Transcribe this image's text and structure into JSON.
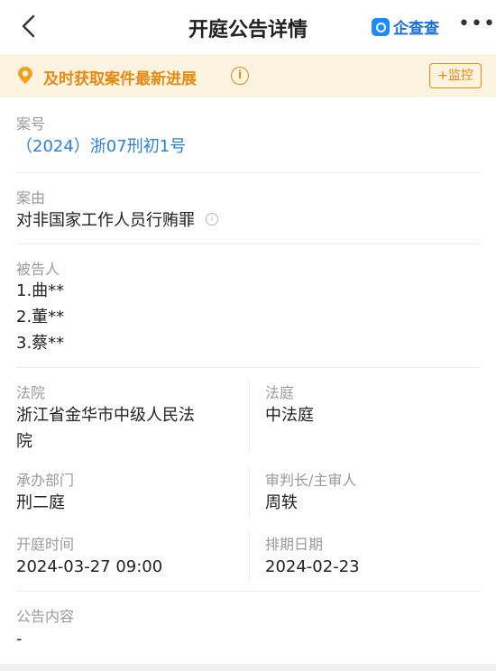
{
  "header": {
    "title": "开庭公告详情",
    "brand": "企查查"
  },
  "banner": {
    "text": "及时获取案件最新进展",
    "button": "+监控"
  },
  "case_number": {
    "label": "案号",
    "value": "（2024）浙07刑初1号"
  },
  "cause": {
    "label": "案由",
    "value": "对非国家工作人员行贿罪"
  },
  "defendants": {
    "label": "被告人",
    "items": [
      "1.曲**",
      "2.董**",
      "3.蔡**"
    ]
  },
  "court": {
    "label": "法院",
    "line1": "浙江省金华市中级人民法",
    "line2": "院"
  },
  "courtroom": {
    "label": "法庭",
    "value": "中法庭"
  },
  "department": {
    "label": "承办部门",
    "value": "刑二庭"
  },
  "judge": {
    "label": "审判长/主审人",
    "value": "周轶"
  },
  "hearing_time": {
    "label": "开庭时间",
    "value": "2024-03-27 09:00"
  },
  "schedule_date": {
    "label": "排期日期",
    "value": "2024-02-23"
  },
  "content": {
    "label": "公告内容",
    "value": "-"
  },
  "colors": {
    "accent": "#e58b12",
    "link": "#2f7fd8",
    "brand": "#1a6fd6"
  }
}
